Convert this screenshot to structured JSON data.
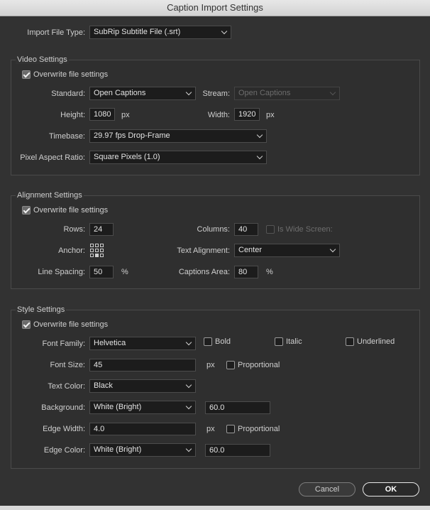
{
  "window": {
    "title": "Caption Import Settings"
  },
  "import": {
    "label": "Import File Type:",
    "value": "SubRip Subtitle File (.srt)"
  },
  "video": {
    "section_label": "Video Settings",
    "overwrite_label": "Overwrite file settings",
    "overwrite_checked": true,
    "standard_label": "Standard:",
    "standard_value": "Open Captions",
    "stream_label": "Stream:",
    "stream_value": "Open Captions",
    "height_label": "Height:",
    "height_value": "1080",
    "width_label": "Width:",
    "width_value": "1920",
    "px": "px",
    "timebase_label": "Timebase:",
    "timebase_value": "29.97 fps Drop-Frame",
    "par_label": "Pixel Aspect Ratio:",
    "par_value": "Square Pixels (1.0)"
  },
  "alignment": {
    "section_label": "Alignment Settings",
    "overwrite_label": "Overwrite file settings",
    "overwrite_checked": true,
    "rows_label": "Rows:",
    "rows_value": "24",
    "columns_label": "Columns:",
    "columns_value": "40",
    "widescreen_label": "Is Wide Screen:",
    "anchor_label": "Anchor:",
    "text_alignment_label": "Text Alignment:",
    "text_alignment_value": "Center",
    "line_spacing_label": "Line Spacing:",
    "line_spacing_value": "50",
    "percent": "%",
    "captions_area_label": "Captions Area:",
    "captions_area_value": "80"
  },
  "style": {
    "section_label": "Style Settings",
    "overwrite_label": "Overwrite file settings",
    "overwrite_checked": true,
    "font_family_label": "Font Family:",
    "font_family_value": "Helvetica",
    "bold_label": "Bold",
    "italic_label": "Italic",
    "underlined_label": "Underlined",
    "font_size_label": "Font Size:",
    "font_size_value": "45",
    "px": "px",
    "proportional_label": "Proportional",
    "text_color_label": "Text Color:",
    "text_color_value": "Black",
    "background_label": "Background:",
    "background_value": "White (Bright)",
    "background_opacity": "60.0",
    "edge_width_label": "Edge Width:",
    "edge_width_value": "4.0",
    "edge_color_label": "Edge Color:",
    "edge_color_value": "White (Bright)",
    "edge_color_opacity": "60.0"
  },
  "buttons": {
    "cancel": "Cancel",
    "ok": "OK"
  }
}
